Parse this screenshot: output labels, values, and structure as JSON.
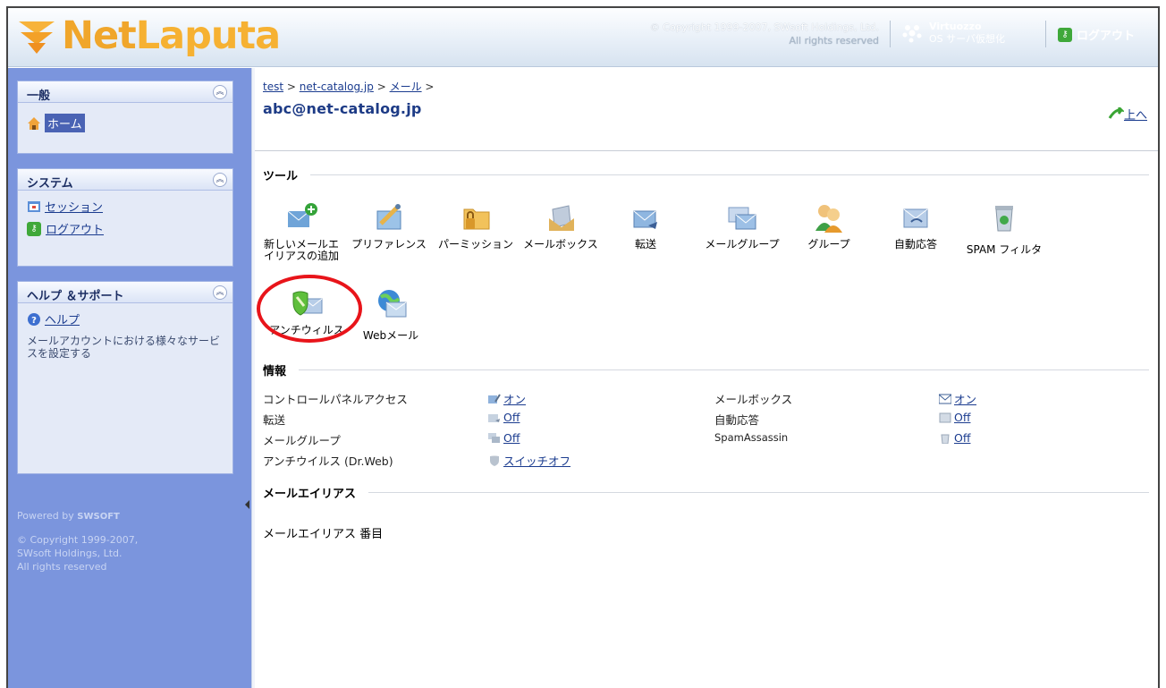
{
  "header": {
    "logo_net": "Net",
    "logo_laputa": "Laputa",
    "copyright_line1": "© Copyright 1999-2007, SWsoft Holdings, Ltd.",
    "copyright_line2": "All rights reserved",
    "virtuozzo_title": "Virtuozzo",
    "virtuozzo_sub": "OS サーバ仮想化",
    "logout_label": "ログアウト"
  },
  "sidebar": {
    "general": {
      "title": "一般",
      "items": [
        {
          "label": "ホーム",
          "icon": "home-icon"
        }
      ]
    },
    "system": {
      "title": "システム",
      "items": [
        {
          "label": "セッション",
          "icon": "session-icon"
        },
        {
          "label": "ログアウト",
          "icon": "key-icon"
        }
      ]
    },
    "help": {
      "title": "ヘルプ ＆サポート",
      "items": [
        {
          "label": "ヘルプ",
          "icon": "help-icon"
        }
      ],
      "description": "メールアカウントにおける様々なサービスを設定する"
    },
    "powered_by": "Powered by",
    "powered_brand": "SWSOFT",
    "copyright": [
      "© Copyright 1999-2007,",
      "SWsoft Holdings, Ltd.",
      "All rights reserved"
    ]
  },
  "main": {
    "breadcrumb": {
      "items": [
        "test",
        "net-catalog.jp",
        "メール"
      ],
      "separator": ">"
    },
    "title": "abc@net-catalog.jp",
    "up_label": "上へ",
    "tools_title": "ツール",
    "tools": [
      {
        "label1": "新しいメールエ",
        "label2": "イリアスの追加",
        "icon": "add-mail-alias-icon"
      },
      {
        "label1": "プリファレンス",
        "label2": "",
        "icon": "preferences-icon"
      },
      {
        "label1": "パーミッション",
        "label2": "",
        "icon": "permissions-icon"
      },
      {
        "label1": "メールボックス",
        "label2": "",
        "icon": "mailbox-icon"
      },
      {
        "label1": "転送",
        "label2": "",
        "icon": "forwarding-icon"
      },
      {
        "label1": "メールグループ",
        "label2": "",
        "icon": "mail-group-icon"
      },
      {
        "label1": "グループ",
        "label2": "",
        "icon": "group-icon"
      },
      {
        "label1": "自動応答",
        "label2": "",
        "icon": "autoresponder-icon"
      },
      {
        "label1": "SPAM フィルタ",
        "label2": "",
        "icon": "spam-filter-icon"
      },
      {
        "label1": "アンチウィルス",
        "label2": "",
        "icon": "antivirus-icon"
      },
      {
        "label1": "Webメール",
        "label2": "",
        "icon": "webmail-icon"
      }
    ],
    "info_title": "情報",
    "info": [
      {
        "label": "コントロールパネルアクセス",
        "value": "オン"
      },
      {
        "label": "転送",
        "value": "Off"
      },
      {
        "label": "メールグループ",
        "value": "Off"
      },
      {
        "label": "アンチウイルス (Dr.Web)",
        "value": "スイッチオフ"
      },
      {
        "label": "メールボックス",
        "value": "オン"
      },
      {
        "label": "自動応答",
        "value": "Off"
      },
      {
        "label": "SpamAssassin",
        "value": "Off"
      }
    ],
    "alias_title": "メールエイリアス",
    "alias_text": "メールエイリアス 番目"
  },
  "colors": {
    "sidebar_bg": "#7b95dd",
    "logo_orange": "#f5a623",
    "highlight_red": "#e8141a",
    "link_blue": "#1b3c8f"
  }
}
